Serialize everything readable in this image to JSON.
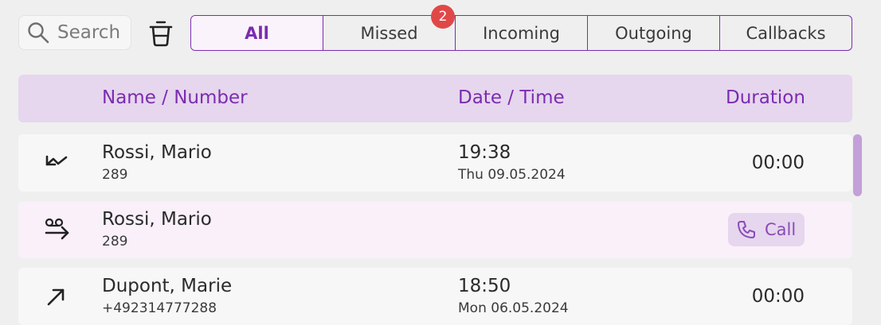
{
  "search": {
    "placeholder": "Search"
  },
  "tabs": [
    {
      "label": "All",
      "active": true
    },
    {
      "label": "Missed",
      "badge": "2"
    },
    {
      "label": "Incoming"
    },
    {
      "label": "Outgoing"
    },
    {
      "label": "Callbacks"
    }
  ],
  "columns": {
    "name": "Name / Number",
    "datetime": "Date / Time",
    "duration": "Duration"
  },
  "rows": [
    {
      "icon": "incoming-call-icon",
      "name": "Rossi, Mario",
      "number": "289",
      "time": "19:38",
      "date": "Thu 09.05.2024",
      "duration": "00:00"
    },
    {
      "icon": "voicemail-forward-icon",
      "name": "Rossi, Mario",
      "number": "289",
      "action": "Call"
    },
    {
      "icon": "outgoing-call-icon",
      "name": "Dupont, Marie",
      "number": "+492314777288",
      "time": "18:50",
      "date": "Mon 06.05.2024",
      "duration": "00:00"
    }
  ],
  "colors": {
    "accent": "#7b2cb0",
    "header_bg": "#e6d6ee",
    "badge": "#e04848",
    "row_alt": "#f9f0fa"
  }
}
